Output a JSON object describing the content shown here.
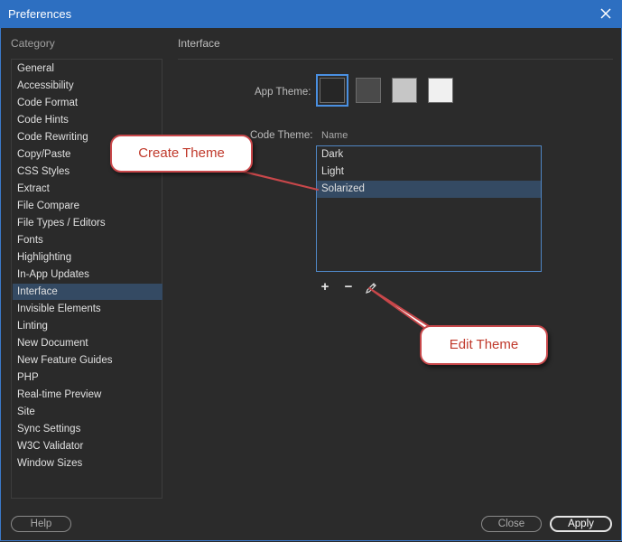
{
  "window": {
    "title": "Preferences"
  },
  "sidebar": {
    "heading": "Category",
    "items": [
      "General",
      "Accessibility",
      "Code Format",
      "Code Hints",
      "Code Rewriting",
      "Copy/Paste",
      "CSS Styles",
      "Extract",
      "File Compare",
      "File Types / Editors",
      "Fonts",
      "Highlighting",
      "In-App Updates",
      "Interface",
      "Invisible Elements",
      "Linting",
      "New Document",
      "New Feature Guides",
      "PHP",
      "Real-time Preview",
      "Site",
      "Sync Settings",
      "W3C Validator",
      "Window Sizes"
    ],
    "selected": "Interface"
  },
  "panel": {
    "heading": "Interface",
    "app_theme_label": "App Theme:",
    "app_theme_swatches": [
      "#262626",
      "#4a4a4a",
      "#c6c6c6",
      "#f0f0f0"
    ],
    "app_theme_selected_index": 0,
    "code_theme_label": "Code Theme:",
    "code_theme_column_header": "Name",
    "code_themes": [
      "Dark",
      "Light",
      "Solarized"
    ],
    "code_theme_selected": "Solarized"
  },
  "tools": {
    "add_label": "+",
    "remove_label": "−"
  },
  "buttons": {
    "help": "Help",
    "close": "Close",
    "apply": "Apply"
  },
  "annotations": {
    "create_theme": "Create Theme",
    "edit_theme": "Edit Theme"
  },
  "colors": {
    "accent": "#2d6fc1",
    "selection": "#344a63",
    "callout_border": "#c8474a",
    "callout_text": "#c0392b"
  }
}
